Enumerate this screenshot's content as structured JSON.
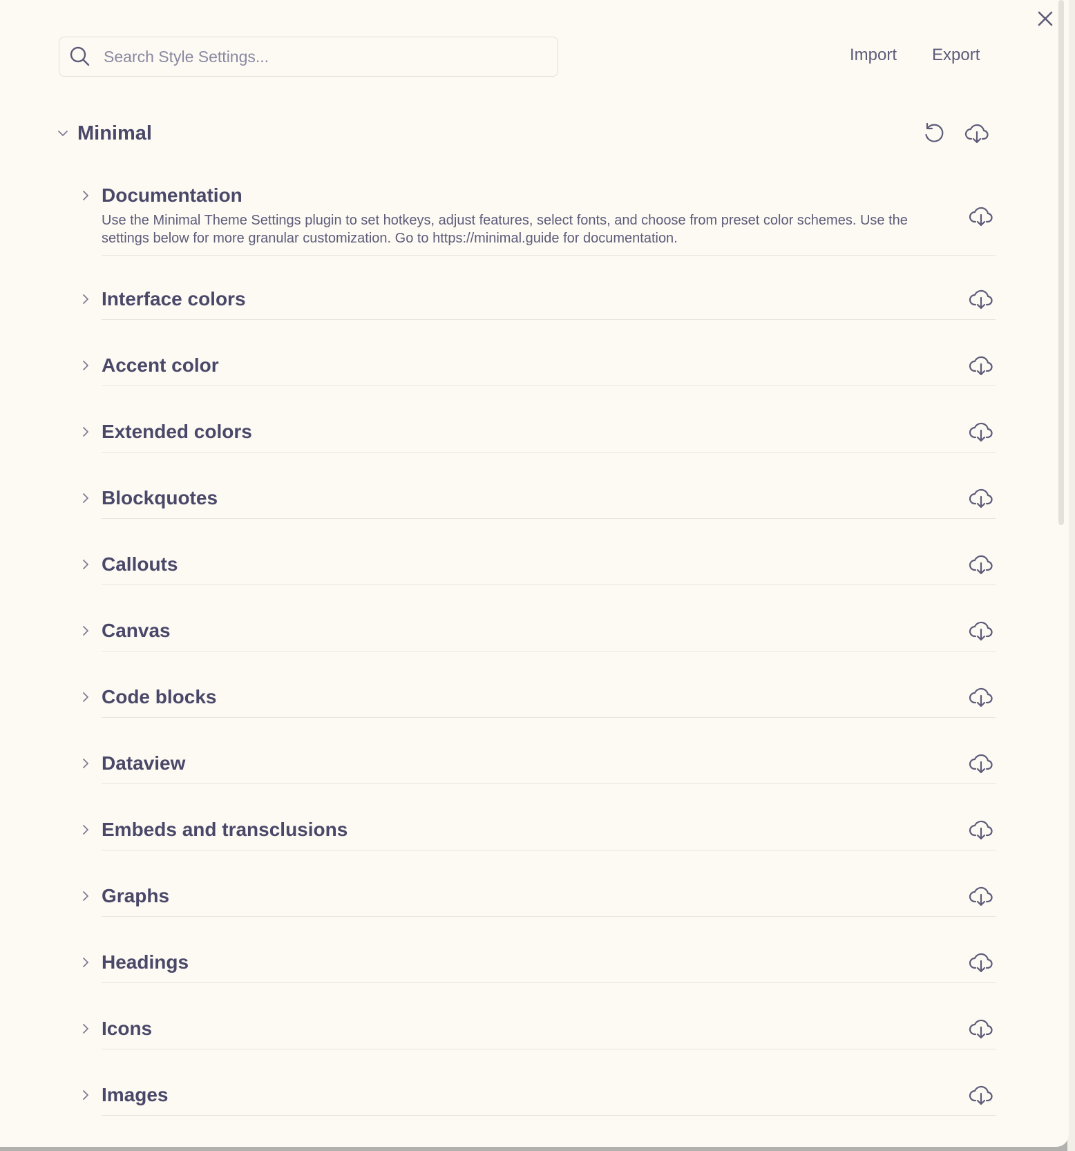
{
  "search": {
    "placeholder": "Search Style Settings..."
  },
  "toolbar": {
    "import_label": "Import",
    "export_label": "Export"
  },
  "section": {
    "title": "Minimal"
  },
  "items": [
    {
      "title": "Documentation",
      "description": "Use the Minimal Theme Settings plugin to set hotkeys, adjust features, select fonts, and choose from preset color schemes. Use the settings below for more granular customization. Go to https://minimal.guide for documentation."
    },
    {
      "title": "Interface colors"
    },
    {
      "title": "Accent color"
    },
    {
      "title": "Extended colors"
    },
    {
      "title": "Blockquotes"
    },
    {
      "title": "Callouts"
    },
    {
      "title": "Canvas"
    },
    {
      "title": "Code blocks"
    },
    {
      "title": "Dataview"
    },
    {
      "title": "Embeds and transclusions"
    },
    {
      "title": "Graphs"
    },
    {
      "title": "Headings"
    },
    {
      "title": "Icons"
    },
    {
      "title": "Images"
    }
  ],
  "colors": {
    "text": "#4a4868",
    "muted": "#5d5b78",
    "background": "#fdfaf4",
    "divider": "#e8e5df"
  },
  "icons": {
    "close": "close-icon",
    "search": "search-icon",
    "reset": "reset-icon",
    "download": "cloud-download-icon",
    "collapse": "chevron-down-icon",
    "expand": "chevron-right-icon"
  }
}
